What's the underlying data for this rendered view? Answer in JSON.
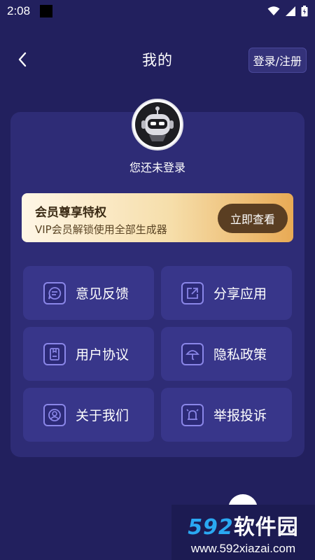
{
  "status_bar": {
    "time": "2:08"
  },
  "header": {
    "title": "我的",
    "login_label": "登录/注册"
  },
  "profile": {
    "name": "您还未登录"
  },
  "vip": {
    "title": "会员尊享特权",
    "subtitle": "VIP会员解锁使用全部生成器",
    "button_label": "立即查看"
  },
  "menu": [
    {
      "label": "意见反馈",
      "icon": "feedback-icon"
    },
    {
      "label": "分享应用",
      "icon": "share-icon"
    },
    {
      "label": "用户协议",
      "icon": "document-icon"
    },
    {
      "label": "隐私政策",
      "icon": "umbrella-icon"
    },
    {
      "label": "关于我们",
      "icon": "person-icon"
    },
    {
      "label": "举报投诉",
      "icon": "report-bell-icon"
    }
  ],
  "watermark": {
    "brand_num": "592",
    "brand_text": "软件园",
    "url": "www.592xiazai.com"
  },
  "colors": {
    "background": "#22205e",
    "card": "#2e2c76",
    "menu_item": "#38368a",
    "vip_button": "#5a3e22",
    "accent": "#2aa8f2"
  }
}
